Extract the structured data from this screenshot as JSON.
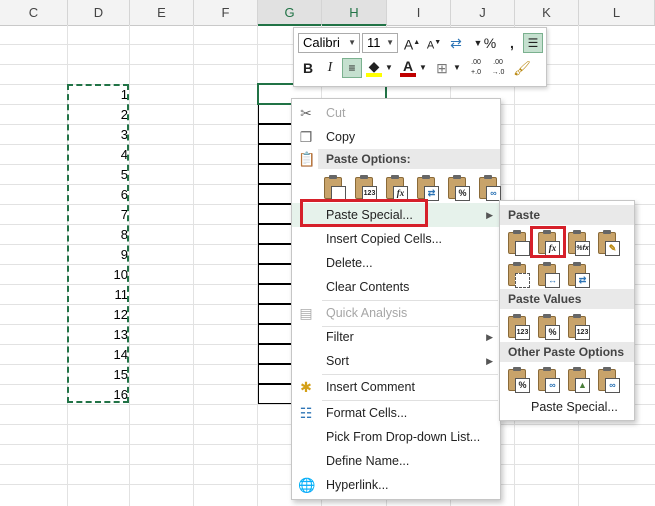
{
  "columns": [
    "C",
    "D",
    "E",
    "F",
    "G",
    "H",
    "I",
    "J",
    "K",
    "L"
  ],
  "selected_columns": [
    "G",
    "H"
  ],
  "cell_values": [
    "1",
    "2",
    "3",
    "4",
    "5",
    "6",
    "7",
    "8",
    "9",
    "10",
    "11",
    "12",
    "13",
    "14",
    "15",
    "16"
  ],
  "mini_toolbar": {
    "font_name": "Calibri",
    "font_size": "11",
    "bold": "B",
    "italic": "I",
    "percent": "%",
    "comma": ",",
    "increase_decimal": ".00",
    "decrease_decimal": ".00"
  },
  "context_menu": {
    "cut": "Cut",
    "copy": "Copy",
    "paste_options": "Paste Options:",
    "paste_special": "Paste Special...",
    "insert_copied_cells": "Insert Copied Cells...",
    "delete": "Delete...",
    "clear_contents": "Clear Contents",
    "quick_analysis": "Quick Analysis",
    "filter": "Filter",
    "sort": "Sort",
    "insert_comment": "Insert Comment",
    "format_cells": "Format Cells...",
    "pick_from_dropdown": "Pick From Drop-down List...",
    "define_name": "Define Name...",
    "hyperlink": "Hyperlink..."
  },
  "paste_option_tiles": [
    "",
    "123",
    "fx",
    "",
    "%",
    ""
  ],
  "submenu": {
    "paste": "Paste",
    "paste_values": "Paste Values",
    "other_paste_options": "Other Paste Options",
    "paste_special": "Paste Special...",
    "paste_tiles": [
      "",
      "fx",
      "%fx",
      "",
      "",
      "",
      ""
    ],
    "values_tiles": [
      "123",
      "%",
      "123"
    ],
    "other_tiles": [
      "%",
      "",
      "",
      ""
    ]
  },
  "colors": {
    "accent_green": "#217346",
    "highlight_red": "#d6202a",
    "font_color_red": "#c00000",
    "fill_yellow": "#ffff00"
  }
}
